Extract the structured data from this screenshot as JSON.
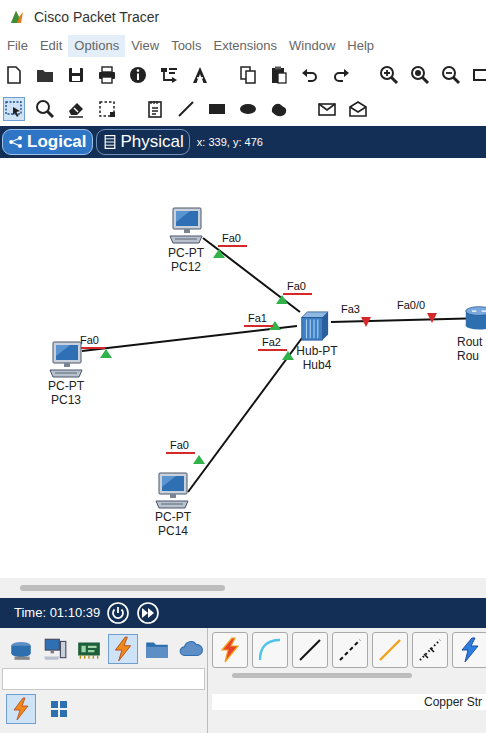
{
  "window": {
    "title": "Cisco Packet Tracer"
  },
  "menu": [
    {
      "label": "File",
      "selected": false
    },
    {
      "label": "Edit",
      "selected": false
    },
    {
      "label": "Options",
      "selected": true
    },
    {
      "label": "View",
      "selected": false
    },
    {
      "label": "Tools",
      "selected": false
    },
    {
      "label": "Extensions",
      "selected": false
    },
    {
      "label": "Window",
      "selected": false
    },
    {
      "label": "Help",
      "selected": false
    }
  ],
  "tools": [
    {
      "selected": false
    },
    {
      "selected": false
    },
    {
      "selected": false
    },
    {
      "selected": false
    },
    {
      "selected": false
    },
    {
      "selected": false
    },
    {
      "selected": false
    },
    {
      "selected": false
    },
    {
      "selected": false
    },
    {
      "selected": false
    },
    {
      "selected": false
    },
    {
      "selected": false
    },
    {
      "selected": false
    },
    {
      "selected": false
    },
    {
      "selected": false
    }
  ],
  "edit_tools": [
    {
      "selected": true
    },
    {
      "selected": false
    },
    {
      "selected": false
    },
    {
      "selected": false
    },
    {
      "selected": false
    },
    {
      "selected": false
    },
    {
      "selected": false
    },
    {
      "selected": false
    },
    {
      "selected": false
    },
    {
      "selected": false
    },
    {
      "selected": false
    }
  ],
  "tabs": [
    {
      "label": "Logical",
      "selected": true
    },
    {
      "label": "Physical",
      "selected": false
    }
  ],
  "coordinates": "x: 339, y: 476",
  "devices": [
    {
      "model": "PC-PT",
      "name": "PC12",
      "kind": "pc"
    },
    {
      "model": "PC-PT",
      "name": "PC13",
      "kind": "pc"
    },
    {
      "model": "PC-PT",
      "name": "PC14",
      "kind": "pc"
    },
    {
      "model": "Hub-PT",
      "name": "Hub4",
      "kind": "hub"
    },
    {
      "model": "Rout",
      "name": "Rou",
      "kind": "router"
    }
  ],
  "links": [
    {
      "ends": [
        {
          "port": "Fa0",
          "up": true
        },
        {
          "port": "Fa0",
          "up": true
        }
      ]
    },
    {
      "ends": [
        {
          "port": "Fa0",
          "up": true
        },
        {
          "port": "Fa1",
          "up": true
        }
      ]
    },
    {
      "ends": [
        {
          "port": "Fa0",
          "up": true
        },
        {
          "port": "Fa2",
          "up": true
        }
      ]
    },
    {
      "ends": [
        {
          "port": "Fa3",
          "up": false
        },
        {
          "port": "Fa0/0",
          "up": false
        }
      ]
    }
  ],
  "time": "Time: 01:10:39",
  "device_categories": [
    {
      "selected": false
    },
    {
      "selected": false
    },
    {
      "selected": false
    },
    {
      "selected": true
    },
    {
      "selected": false
    },
    {
      "selected": false
    }
  ],
  "sub_categories": [
    {
      "selected": true
    },
    {
      "selected": false
    }
  ],
  "hint": "Copper Str"
}
